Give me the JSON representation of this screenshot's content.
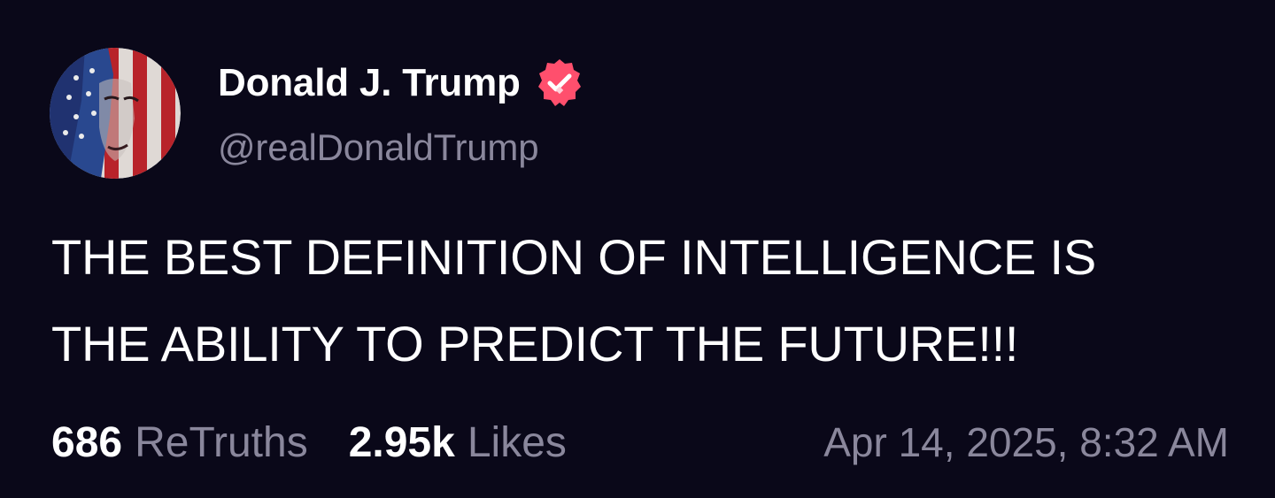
{
  "post": {
    "author": {
      "display_name": "Donald J. Trump",
      "handle": "@realDonaldTrump",
      "verified": true,
      "verified_icon": "verified-badge-icon",
      "avatar_icon": "avatar-flag-portrait"
    },
    "text_lines": [
      "THE BEST DEFINITION OF INTELLIGENCE IS",
      "THE ABILITY TO PREDICT THE FUTURE!!!"
    ],
    "stats": {
      "retruths_count": "686",
      "retruths_label": "ReTruths",
      "likes_count": "2.95k",
      "likes_label": "Likes"
    },
    "timestamp": "Apr 14, 2025, 8:32 AM"
  },
  "colors": {
    "background": "#0a0819",
    "text_primary": "#ffffff",
    "text_secondary": "#8a879c",
    "verified_badge": "#ff4f6d"
  }
}
